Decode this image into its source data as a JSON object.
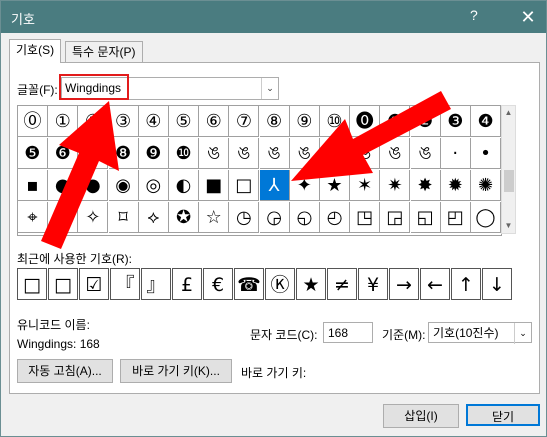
{
  "window": {
    "title": "기호",
    "help": "?",
    "close": "✕"
  },
  "tabs": [
    "기호(S)",
    "특수 문자(P)"
  ],
  "font": {
    "label": "글꼴(F):",
    "value": "Wingdings",
    "dropdown": "⌄"
  },
  "grid": {
    "rows": [
      [
        "⓪",
        "①",
        "②",
        "③",
        "④",
        "⑤",
        "⑥",
        "⑦",
        "⑧",
        "⑨",
        "⑩",
        "⓿",
        "❶",
        "❷",
        "❸",
        "❹"
      ],
      [
        "❺",
        "❻",
        "❼",
        "❽",
        "❾",
        "❿",
        "ঙ",
        "ঙ",
        "ঙ",
        "ঙ",
        "ঙ",
        "ঙ",
        "ঙ",
        "ঙ",
        "·",
        "•"
      ],
      [
        "▪",
        "●",
        "●",
        "◉",
        "◎",
        "◐",
        "■",
        "□",
        "⅄",
        "✦",
        "★",
        "✶",
        "✷",
        "✸",
        "✹",
        "✺"
      ],
      [
        "⌖",
        "⊹",
        "✧",
        "⌑",
        "⟡",
        "✪",
        "☆",
        "◷",
        "◶",
        "◵",
        "◴",
        "◳",
        "◲",
        "◱",
        "◰",
        "◯"
      ]
    ],
    "selected_row": 2,
    "selected_col": 8
  },
  "recent": {
    "label": "최근에 사용한 기호(R):",
    "items": [
      "□",
      "□",
      "☑",
      "『",
      "』",
      "£",
      "€",
      "☎",
      "Ⓚ",
      "★",
      "≠",
      "¥",
      "→",
      "←",
      "↑",
      "↓"
    ]
  },
  "info": {
    "unicode_name_label": "유니코드 이름:",
    "unicode_name_value": "Wingdings: 168",
    "code_label": "문자 코드(C):",
    "code_value": "168",
    "base_label": "기준(M):",
    "base_value": "기호(10진수)"
  },
  "buttons": {
    "autocorrect": "자동 고침(A)...",
    "shortcut_key": "바로 가기 키(K)...",
    "shortcut_label": "바로 가기 키:",
    "insert": "삽입(I)",
    "close": "닫기"
  }
}
